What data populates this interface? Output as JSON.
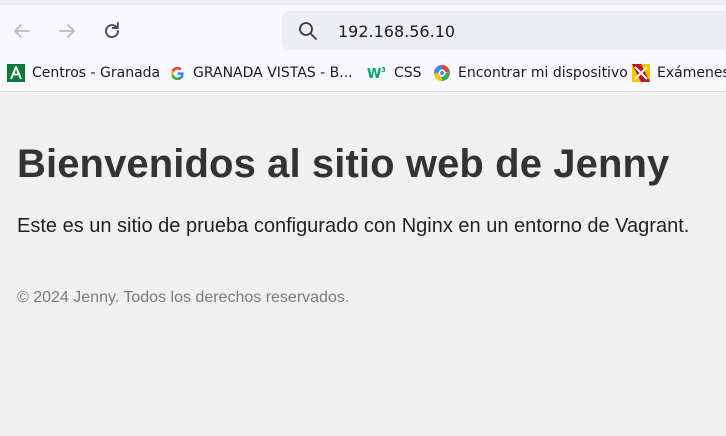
{
  "browser": {
    "address": "192.168.56.10",
    "bookmarks": [
      {
        "label": "Centros - Granada",
        "icon": "junta-andalucia-icon"
      },
      {
        "label": "GRANADA VISTAS - B...",
        "icon": "google-icon"
      },
      {
        "label": "CSS",
        "icon": "w3schools-icon"
      },
      {
        "label": "Encontrar mi dispositivo",
        "icon": "find-device-icon"
      },
      {
        "label": "Exámenes",
        "icon": "examenes-icon"
      }
    ]
  },
  "page": {
    "heading": "Bienvenidos al sitio web de Jenny",
    "intro": "Este es un sitio de prueba configurado con Nginx en un entorno de Vagrant.",
    "footer": "© 2024 Jenny. Todos los derechos reservados."
  },
  "colors": {
    "page_background": "#f0f0f0",
    "heading": "#333333",
    "footer_text": "#7a7a7a"
  }
}
